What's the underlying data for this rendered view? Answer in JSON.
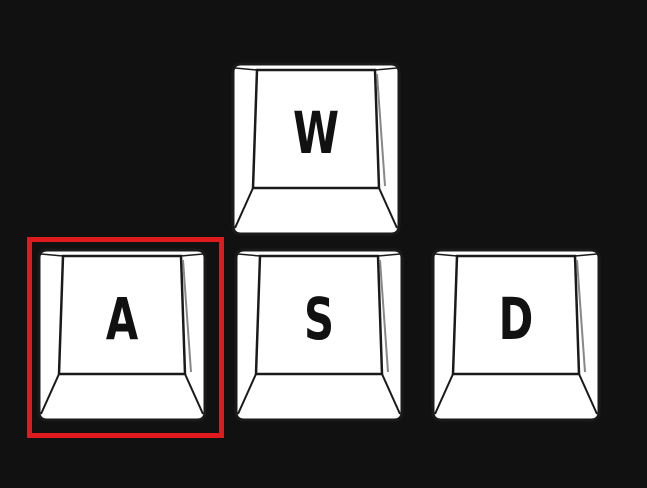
{
  "keys": [
    {
      "id": "w",
      "label": "W"
    },
    {
      "id": "a",
      "label": "A"
    },
    {
      "id": "s",
      "label": "S"
    },
    {
      "id": "d",
      "label": "D"
    }
  ],
  "highlight": {
    "target": "a",
    "color": "#e0191c"
  },
  "colors": {
    "background": "#111111",
    "keycap": "#ffffff",
    "outline": "#1a1a1a"
  }
}
